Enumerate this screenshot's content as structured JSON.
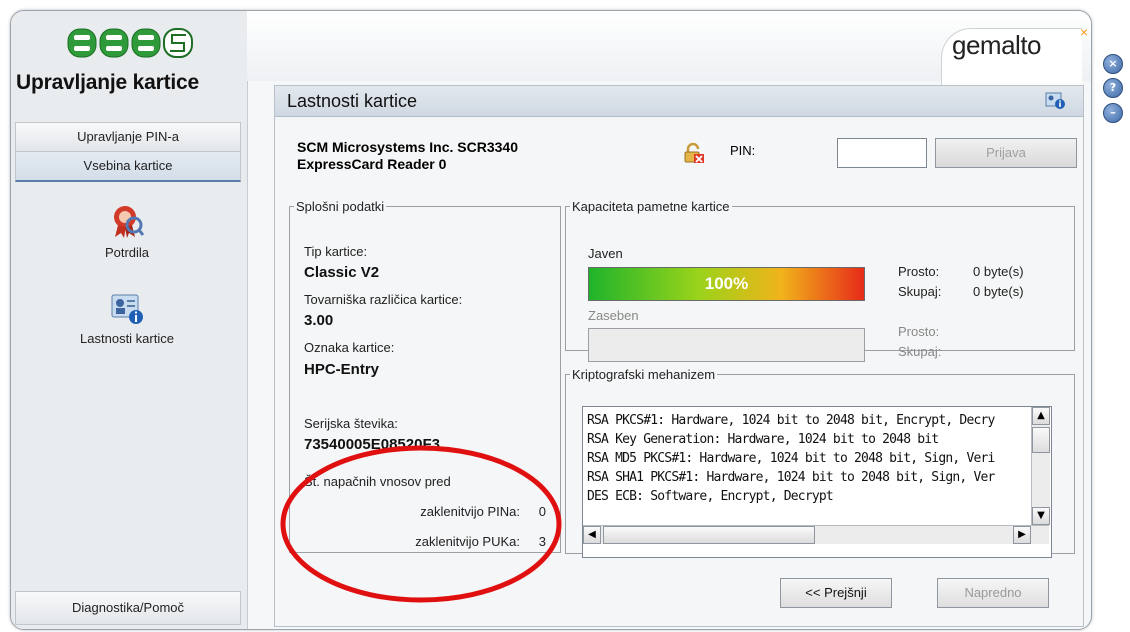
{
  "sidebar": {
    "title": "Upravljanje kartice",
    "tabs": {
      "pin": "Upravljanje PIN-a",
      "content": "Vsebina kartice",
      "diag": "Diagnostika/Pomoč"
    },
    "items": {
      "certs": "Potrdila",
      "props": "Lastnosti kartice"
    }
  },
  "brand": {
    "name": "gemalto",
    "star": "×"
  },
  "window_buttons": {
    "close": "×",
    "help": "?",
    "minimize": "–"
  },
  "panel": {
    "title": "Lastnosti kartice",
    "reader": "SCM Microsystems Inc. SCR3340 ExpressCard Reader 0",
    "pin_label": "PIN:",
    "pin_value": "",
    "login_button": "Prijava",
    "general": {
      "legend": "Splošni podatki",
      "type_label": "Tip kartice:",
      "type_value": "Classic V2",
      "factory_label": "Tovarniška različica kartice:",
      "factory_value": "3.00",
      "tag_label": "Oznaka kartice:",
      "tag_value": "HPC-Entry",
      "serial_label": "Serijska števika:",
      "serial_value": "73540005E08520F3",
      "attempts_label": "Št. napačnih vnosov pred",
      "pin_attempts_label": "zaklenitvijo PINa:",
      "pin_attempts_value": "0",
      "puk_attempts_label": "zaklenitvijo PUKa:",
      "puk_attempts_value": "3"
    },
    "capacity": {
      "legend": "Kapaciteta pametne kartice",
      "public_label": "Javen",
      "public_percent": "100%",
      "public_fill": 1.0,
      "public_free_label": "Prosto:",
      "public_free_value": "0 byte(s)",
      "public_total_label": "Skupaj:",
      "public_total_value": "0 byte(s)",
      "private_label": "Zaseben",
      "private_free_label": "Prosto:",
      "private_total_label": "Skupaj:"
    },
    "crypto": {
      "legend": "Kriptografski mehanizem",
      "items": [
        "RSA PKCS#1: Hardware, 1024 bit to 2048 bit, Encrypt, Decry",
        "RSA Key Generation: Hardware, 1024 bit to 2048 bit",
        "RSA MD5 PKCS#1: Hardware, 1024 bit to 2048 bit, Sign, Veri",
        "RSA SHA1 PKCS#1: Hardware, 1024 bit to 2048 bit, Sign, Ver",
        "DES ECB: Software, Encrypt, Decrypt"
      ]
    },
    "buttons": {
      "prev": "<< Prejšnji",
      "advanced": "Napredno"
    }
  },
  "colors": {
    "accent_blue": "#5b7ea8",
    "annotation_red": "#e01010",
    "bar_green": "#1fb42b",
    "bar_red": "#e62b1a"
  }
}
